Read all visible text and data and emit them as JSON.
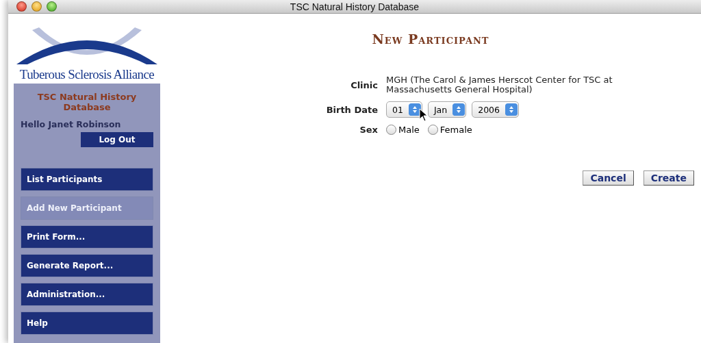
{
  "window": {
    "title": "TSC Natural History Database"
  },
  "sidebar": {
    "logo_text": "Tuberous Sclerosis Alliance",
    "app_name": "TSC Natural History Database",
    "greeting": "Hello Janet Robinson",
    "logout": "Log Out",
    "items": [
      {
        "label": "List Participants",
        "selected": false
      },
      {
        "label": "Add New Participant",
        "selected": true
      },
      {
        "label": "Print Form...",
        "selected": false
      },
      {
        "label": "Generate Report...",
        "selected": false
      },
      {
        "label": "Administration...",
        "selected": false
      },
      {
        "label": "Help",
        "selected": false
      }
    ]
  },
  "form": {
    "title": "New Participant",
    "clinic": {
      "label": "Clinic",
      "value": "MGH (The Carol & James Herscot Center for TSC at Massachusetts General Hospital)"
    },
    "birth_date": {
      "label": "Birth Date",
      "day": "01",
      "month": "Jan",
      "year": "2006"
    },
    "sex": {
      "label": "Sex",
      "options": [
        {
          "label": "Male",
          "checked": false
        },
        {
          "label": "Female",
          "checked": false
        }
      ]
    },
    "buttons": [
      "Cancel",
      "Create"
    ]
  }
}
